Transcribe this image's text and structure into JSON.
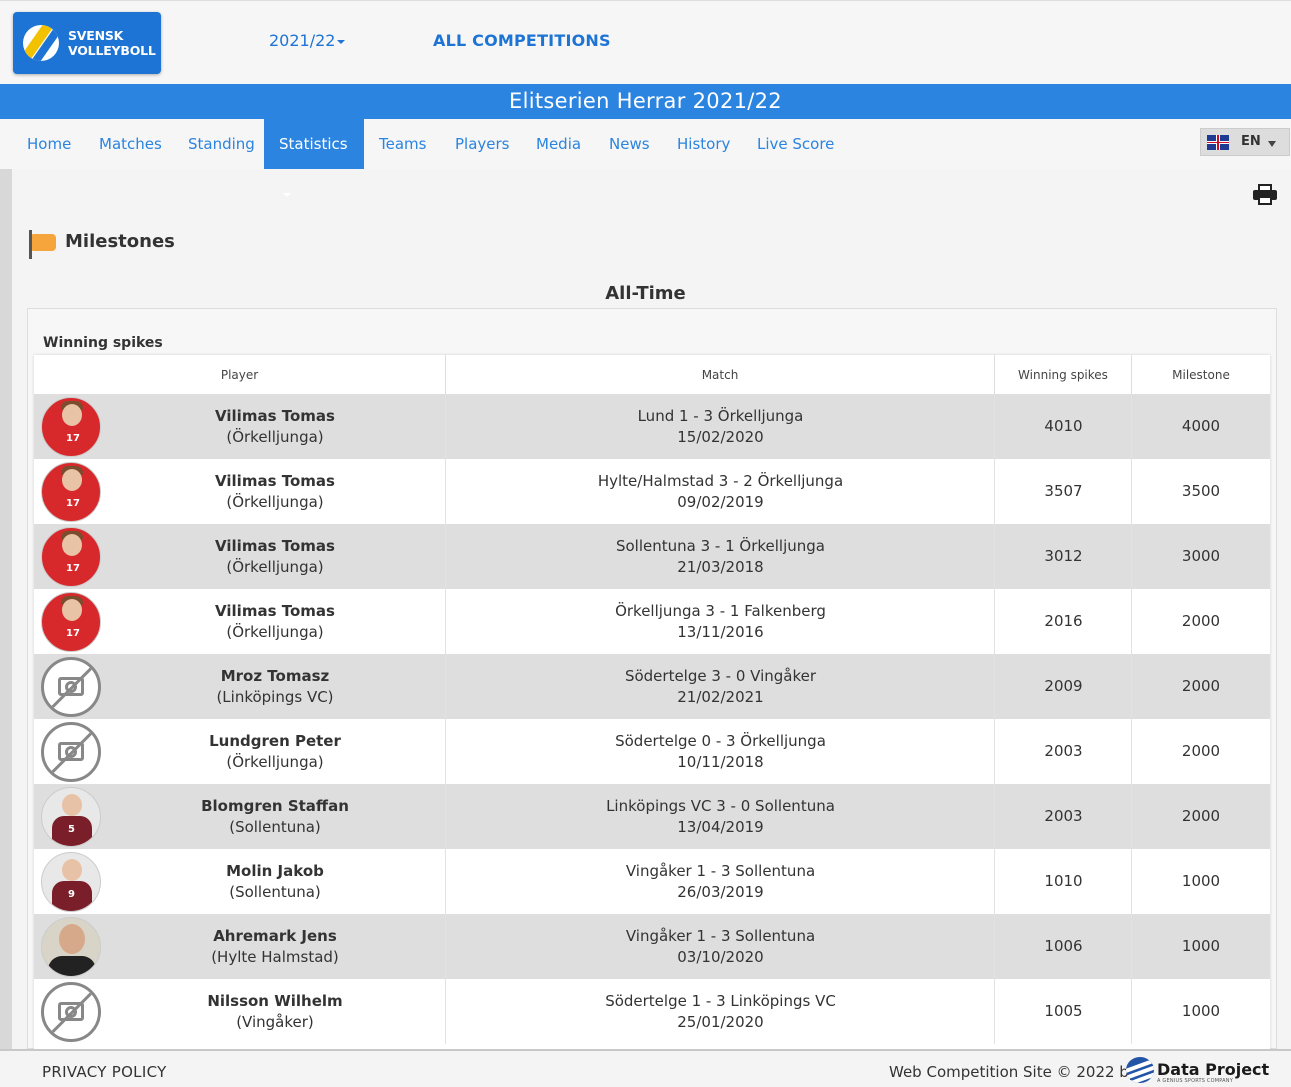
{
  "header": {
    "logo_line1": "SVENSK",
    "logo_line2": "VOLLEYBOLL",
    "season": "2021/22",
    "all_competitions": "ALL COMPETITIONS",
    "competition_title": "Elitserien Herrar 2021/22"
  },
  "nav": {
    "items": [
      {
        "label": "Home"
      },
      {
        "label": "Matches"
      },
      {
        "label": "Standing"
      },
      {
        "label": "Statistics"
      },
      {
        "label": "Teams"
      },
      {
        "label": "Players"
      },
      {
        "label": "Media"
      },
      {
        "label": "News"
      },
      {
        "label": "History"
      },
      {
        "label": "Live Score"
      }
    ],
    "active": "Statistics",
    "language": "EN"
  },
  "page": {
    "section_title": "Milestones",
    "subtitle": "All-Time",
    "panel_label": "Winning spikes"
  },
  "table": {
    "headers": [
      "Player",
      "Match",
      "Winning spikes",
      "Milestone"
    ],
    "rows": [
      {
        "player": "Vilimas Tomas",
        "team": "(Örkelljunga)",
        "match": "Lund 1 - 3 Örkelljunga",
        "date": "15/02/2020",
        "spikes": "4010",
        "milestone": "4000",
        "avatar": "red",
        "shirt": "17"
      },
      {
        "player": "Vilimas Tomas",
        "team": "(Örkelljunga)",
        "match": "Hylte/Halmstad 3 - 2 Örkelljunga",
        "date": "09/02/2019",
        "spikes": "3507",
        "milestone": "3500",
        "avatar": "red",
        "shirt": "17"
      },
      {
        "player": "Vilimas Tomas",
        "team": "(Örkelljunga)",
        "match": "Sollentuna 3 - 1 Örkelljunga",
        "date": "21/03/2018",
        "spikes": "3012",
        "milestone": "3000",
        "avatar": "red",
        "shirt": "17"
      },
      {
        "player": "Vilimas Tomas",
        "team": "(Örkelljunga)",
        "match": "Örkelljunga 3 - 1 Falkenberg",
        "date": "13/11/2016",
        "spikes": "2016",
        "milestone": "2000",
        "avatar": "red",
        "shirt": "17"
      },
      {
        "player": "Mroz Tomasz",
        "team": "(Linköpings VC)",
        "match": "Södertelge 3 - 0 Vingåker",
        "date": "21/02/2021",
        "spikes": "2009",
        "milestone": "2000",
        "avatar": "none",
        "shirt": ""
      },
      {
        "player": "Lundgren Peter",
        "team": "(Örkelljunga)",
        "match": "Södertelge 0 - 3 Örkelljunga",
        "date": "10/11/2018",
        "spikes": "2003",
        "milestone": "2000",
        "avatar": "none",
        "shirt": ""
      },
      {
        "player": "Blomgren Staffan",
        "team": "(Sollentuna)",
        "match": "Linköpings VC 3 - 0 Sollentuna",
        "date": "13/04/2019",
        "spikes": "2003",
        "milestone": "2000",
        "avatar": "maroon",
        "shirt": "5"
      },
      {
        "player": "Molin Jakob",
        "team": "(Sollentuna)",
        "match": "Vingåker 1 - 3 Sollentuna",
        "date": "26/03/2019",
        "spikes": "1010",
        "milestone": "1000",
        "avatar": "maroon",
        "shirt": "9"
      },
      {
        "player": "Ahremark Jens",
        "team": "(Hylte Halmstad)",
        "match": "Vingåker 1 - 3 Sollentuna",
        "date": "03/10/2020",
        "spikes": "1006",
        "milestone": "1000",
        "avatar": "photo",
        "shirt": ""
      },
      {
        "player": "Nilsson Wilhelm",
        "team": "(Vingåker)",
        "match": "Södertelge 1 - 3 Linköpings VC",
        "date": "25/01/2020",
        "spikes": "1005",
        "milestone": "1000",
        "avatar": "none",
        "shirt": ""
      }
    ]
  },
  "footer": {
    "privacy": "PRIVACY POLICY",
    "copyright": "Web Competition Site © 2022 by",
    "brand": "Data Project",
    "brand_sub": "A GENIUS SPORTS COMPANY"
  },
  "colors": {
    "primary": "#2a84e0",
    "logo_bg": "#1d74d4",
    "row_alt": "#dedede",
    "flag": "#f6a53c"
  }
}
